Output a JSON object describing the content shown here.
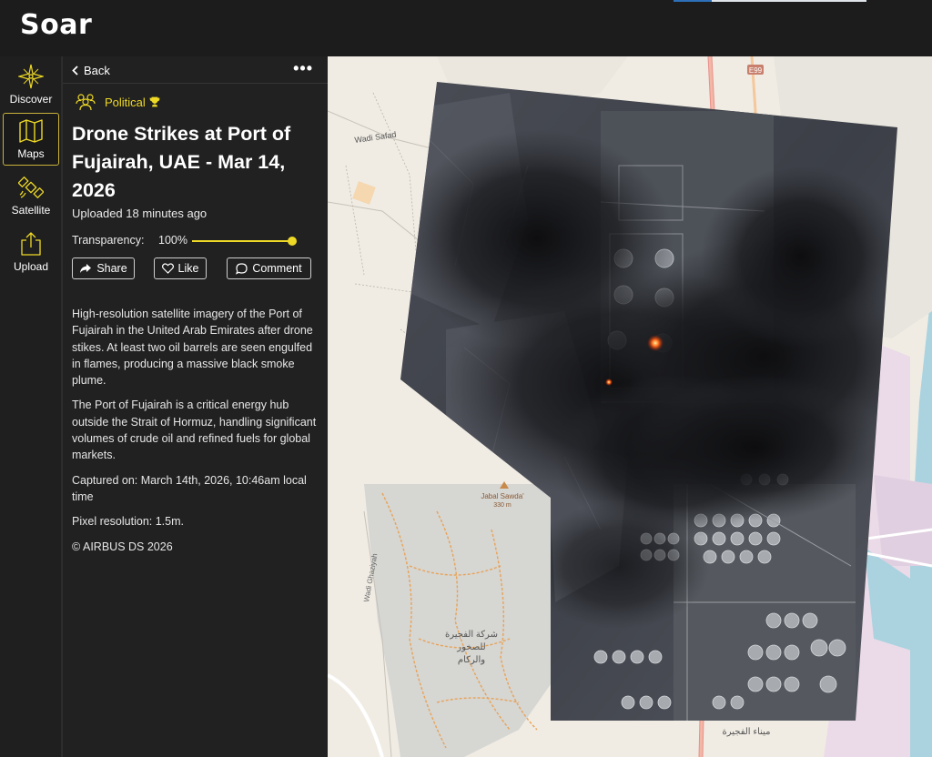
{
  "app": {
    "logo": "Soar"
  },
  "nav": {
    "items": [
      {
        "label": "Discover",
        "icon": "compass-star-icon"
      },
      {
        "label": "Maps",
        "icon": "map-icon",
        "active": true
      },
      {
        "label": "Satellite",
        "icon": "satellite-icon"
      },
      {
        "label": "Upload",
        "icon": "upload-icon"
      }
    ]
  },
  "panel": {
    "back_label": "Back",
    "more_label": "•••",
    "category": "Political",
    "title": "Drone Strikes at Port of Fujairah, UAE - Mar 14, 2026",
    "uploaded": "Uploaded 18 minutes ago",
    "transparency_label": "Transparency:",
    "transparency_value": "100%",
    "transparency_level": 1.0,
    "share_label": "Share",
    "like_label": "Like",
    "comment_label": "Comment",
    "description": [
      "High-resolution satellite imagery of the Port of Fujairah in the United Arab Emirates after drone stikes. At least two oil barrels are seen engulfed in flames, producing a massive black smoke plume.",
      "The Port of Fujairah is a critical energy hub outside the Strait of Hormuz, handling significant volumes of crude oil and refined fuels for global markets.",
      "Captured on: March 14th, 2026, 10:46am local time",
      "Pixel resolution: 1.5m.",
      "© AIRBUS DS 2026"
    ]
  },
  "map": {
    "labels": {
      "road_e99": "E99",
      "wadi_safad": "Wadi Safad",
      "peak_name": "Jabal Sawda'",
      "peak_height": "330 m",
      "wadi_ghaziyah": "Wadi Ghaziyah",
      "quarry_line1": "شركة الفجيرة",
      "quarry_line2": "للصخور",
      "quarry_line3": "والركام",
      "port_name": "ميناء الفجيرة"
    },
    "colors": {
      "land": "#f0ece4",
      "sea": "#aad3df",
      "industrial": "#ebdbe8",
      "quarry": "#d6d6d3",
      "accent": "#eed926"
    }
  }
}
